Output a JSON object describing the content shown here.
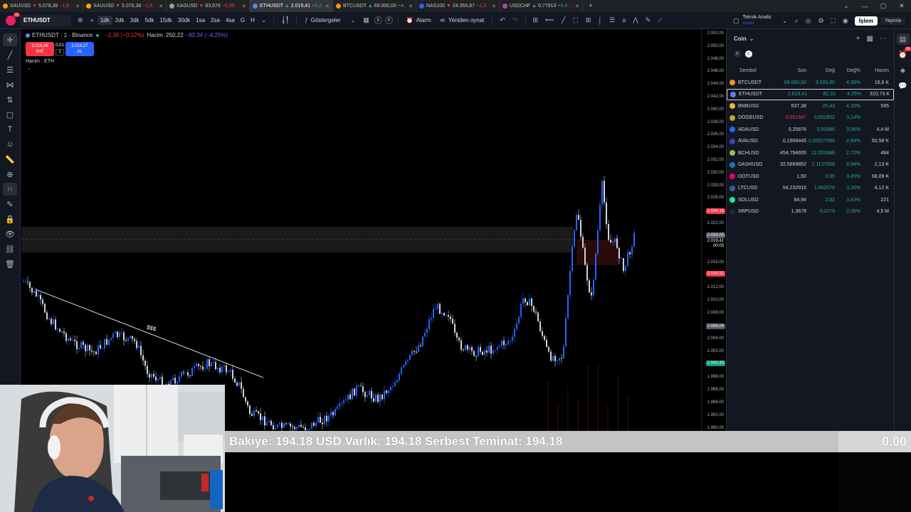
{
  "browser_tabs": [
    {
      "label": "XAUUSD",
      "arrow": "▼",
      "price": "5.078,38",
      "change": "−1,8…",
      "dir": "neg",
      "color": "#f7a600"
    },
    {
      "label": "XAUUSD",
      "arrow": "▼",
      "price": "5.078,38",
      "change": "−1,8…",
      "dir": "neg",
      "color": "#f7a600"
    },
    {
      "label": "XAGUSD",
      "arrow": "▼",
      "price": "83,678",
      "change": "−0,99…",
      "dir": "neg",
      "color": "#9e9e9e"
    },
    {
      "label": "ETHUSDT",
      "arrow": "▲",
      "price": "2.019,41",
      "change": "+4,2…",
      "dir": "pos",
      "color": "#4e8ef7",
      "active": true
    },
    {
      "label": "BTCUSDT",
      "arrow": "▲",
      "price": "69.000,00",
      "change": "+4,…",
      "dir": "pos",
      "color": "#f7931a"
    },
    {
      "label": "NAS100",
      "arrow": "▼",
      "price": "24.355,87",
      "change": "−1,3…",
      "dir": "neg",
      "color": "#2962ff"
    },
    {
      "label": "USDCHF",
      "arrow": "▲",
      "price": "0,77913",
      "change": "+0,4…",
      "dir": "pos",
      "color": "#ab47bc"
    }
  ],
  "toolbar": {
    "avatar_badge": "11",
    "symbol": "ETHUSDT",
    "timeframes": [
      "1dk",
      "2dk",
      "3dk",
      "5dk",
      "15dk",
      "30dk",
      "1sa",
      "2sa",
      "4sa",
      "G",
      "H"
    ],
    "active_timeframe": "1dk",
    "indicators_label": "Göstergeler",
    "count_a": "5",
    "count_b": "0",
    "alarm_label": "Alarm",
    "replay_label": "Yeniden oynat",
    "analysis_title": "Teknik Analiz",
    "analysis_sub": "Kaydet",
    "trade_label": "İşlem",
    "publish_label": "Yayınla"
  },
  "chart": {
    "symbol_line": "ETHUSDT · 1 · Binance",
    "change": "−2,36 (−0,12%)",
    "volume_label": "Hacim",
    "volume_value": "250,22",
    "volume_change": "−82,34 (−4,25%)",
    "sell_price": "2.019,26",
    "sell_label": "SAT",
    "spread": "0,01",
    "qty": "1",
    "buy_price": "2.019,27",
    "buy_label": "AL",
    "volume_pane": "Hacim · ETH",
    "annotation": "$$$"
  },
  "price_axis": {
    "ticks": [
      "2.052,00",
      "2.050,00",
      "2.048,00",
      "2.046,00",
      "2.044,00",
      "2.042,00",
      "2.040,00",
      "2.038,00",
      "2.036,00",
      "2.034,00",
      "2.032,00",
      "2.030,00",
      "2.028,00",
      "2.026,00",
      "2.024,16",
      "2.022,00",
      "2.020,05",
      "2.019,41",
      "00:03",
      "2.016,00",
      "2.014,52",
      "2.012,00",
      "2.010,00",
      "2.008,00",
      "2.006,04",
      "2.004,00",
      "2.002,00",
      "2.000,33",
      "1.998,00",
      "1.996,00",
      "1.994,00",
      "1.992,00",
      "1.990,00"
    ],
    "highlight_red_1": "2.024,16",
    "highlight_grey": "2.020,05",
    "current_price": "2.019,41",
    "countdown": "00:03",
    "highlight_red_2": "2.014,52",
    "highlight_grey_2": "2.006,04",
    "highlight_green": "2.000,33"
  },
  "watchlist": {
    "title": "Coin",
    "filters": [
      "F",
      "C"
    ],
    "columns": {
      "symbol": "Sembol",
      "last": "Son",
      "change": "Değ",
      "change_pct": "Değ%",
      "volume": "Hacim"
    },
    "rows": [
      {
        "symbol": "BTCUSDT",
        "last": "69.000,00",
        "change": "3.028,80",
        "pct": "4,59%",
        "volume": "16,6 K",
        "icon_color": "#f7931a",
        "last_color": "green"
      },
      {
        "symbol": "ETHUSDT",
        "last": "2.019,41",
        "change": "82,31",
        "pct": "4,25%",
        "volume": "310,73 K",
        "icon_color": "#627eea",
        "last_color": "green",
        "selected": true
      },
      {
        "symbol": "BNBUSD",
        "last": "637,38",
        "change": "25,43",
        "pct": "4,16%",
        "volume": "595",
        "icon_color": "#f3ba2f",
        "last_color": ""
      },
      {
        "symbol": "DOGEUSD",
        "last": "0,091947",
        "change": "0,002802",
        "pct": "3,14%",
        "volume": "",
        "icon_color": "#c2a633",
        "last_color": "red"
      },
      {
        "symbol": "ADAUSD",
        "last": "0,25876",
        "change": "0,00986",
        "pct": "3,96%",
        "volume": "4,4 M",
        "icon_color": "#2962ff",
        "last_color": ""
      },
      {
        "symbol": "AVAUSD",
        "last": "0,1908445",
        "change": "0,00527586",
        "pct": "2,84%",
        "volume": "50,58 K",
        "icon_color": "#3949ab",
        "last_color": ""
      },
      {
        "symbol": "BCHUSD",
        "last": "454,794655",
        "change": "12,053888",
        "pct": "2,72%",
        "volume": "484",
        "icon_color": "#8dc351",
        "last_color": ""
      },
      {
        "symbol": "DASHUSD",
        "last": "32,5669852",
        "change": "2,1137008",
        "pct": "6,94%",
        "volume": "2,13 K",
        "icon_color": "#1c75bc",
        "last_color": ""
      },
      {
        "symbol": "DOTUSD",
        "last": "1,50",
        "change": "0,05",
        "pct": "3,45%",
        "volume": "68,09 K",
        "icon_color": "#e6007a",
        "last_color": ""
      },
      {
        "symbol": "LTCUSD",
        "last": "54,232915",
        "change": "1,662078",
        "pct": "3,16%",
        "volume": "4,12 K",
        "icon_color": "#345d9d",
        "last_color": ""
      },
      {
        "symbol": "SOLUSD",
        "last": "84,94",
        "change": "2,82",
        "pct": "3,43%",
        "volume": "221",
        "icon_color": "#14f195",
        "last_color": ""
      },
      {
        "symbol": "XRPUSD",
        "last": "1,3678",
        "change": "0,0279",
        "pct": "2,08%",
        "volume": "4,5 M",
        "icon_color": "#23292f",
        "last_color": ""
      }
    ]
  },
  "right_badge": "26",
  "balance_bar": {
    "text": "Bakiye: 194.18 USD  Varlık: 194.18  Serbest Teminat: 194.18",
    "pnl": "0.00"
  },
  "colors": {
    "up_candle": "#2962ff",
    "down_candle": "#d1d4dc",
    "sell": "#f23645",
    "buy": "#2962ff",
    "positive": "#22ab94",
    "negative": "#f23645"
  }
}
